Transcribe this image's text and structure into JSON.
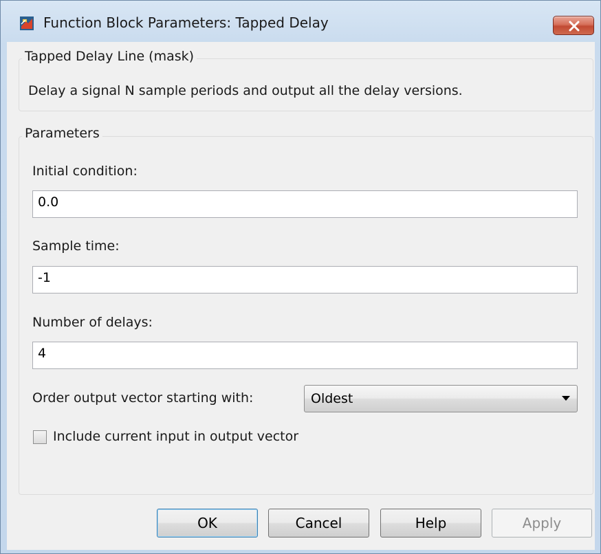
{
  "window": {
    "title": "Function Block Parameters: Tapped Delay",
    "close_icon": "close-icon",
    "app_icon": "simulink-block-icon"
  },
  "description_group": {
    "legend": "Tapped Delay Line (mask)",
    "text": "Delay a signal N sample periods and output all the delay versions."
  },
  "parameters_group": {
    "legend": "Parameters",
    "initial_condition": {
      "label": "Initial condition:",
      "value": "0.0"
    },
    "sample_time": {
      "label": "Sample time:",
      "value": "-1"
    },
    "number_of_delays": {
      "label": "Number of delays:",
      "value": "4"
    },
    "order_output": {
      "label": "Order output vector starting with:",
      "selected": "Oldest"
    },
    "include_current": {
      "label": "Include current input in output vector",
      "checked": false
    }
  },
  "buttons": {
    "ok": "OK",
    "cancel": "Cancel",
    "help": "Help",
    "apply": "Apply"
  },
  "colors": {
    "close_button": "#c24a33",
    "default_button_border": "#3c7fb1",
    "disabled_text": "#8d8d8d"
  }
}
